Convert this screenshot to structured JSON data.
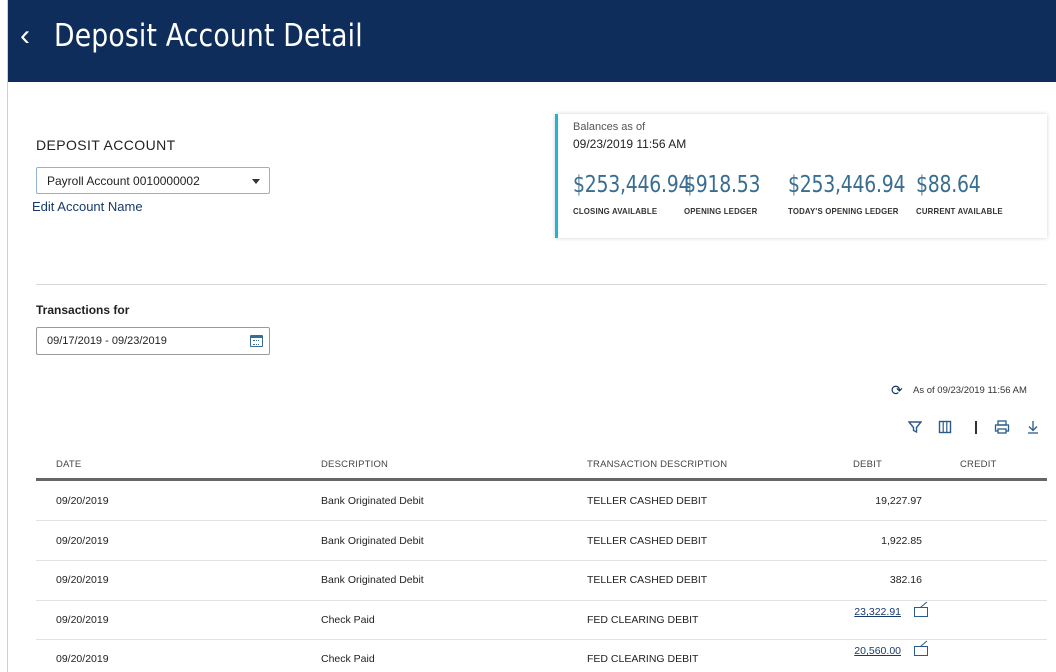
{
  "header": {
    "back_icon": "chevron-left-icon",
    "title": "Deposit Account Detail"
  },
  "account": {
    "label": "DEPOSIT ACCOUNT",
    "selected": "Payroll Account 0010000002",
    "edit_link": "Edit Account Name"
  },
  "balances": {
    "asof_label": "Balances as of",
    "asof_date": "09/23/2019 11:56 AM",
    "accent_color": "#1fb6d1",
    "items": [
      {
        "value": "$253,446.94",
        "caption": "CLOSING AVAILABLE"
      },
      {
        "value": "$918.53",
        "caption": "OPENING LEDGER"
      },
      {
        "value": "$253,446.94",
        "caption": "TODAY'S OPENING LEDGER"
      },
      {
        "value": "$88.64",
        "caption": "CURRENT AVAILABLE"
      }
    ]
  },
  "transactions": {
    "label": "Transactions for",
    "date_range": "09/17/2019 - 09/23/2019",
    "asof": "As of 09/23/2019 11:56 AM",
    "toolbar_icons": [
      "filter-icon",
      "columns-icon",
      "print-icon",
      "download-icon"
    ],
    "columns": [
      "DATE",
      "DESCRIPTION",
      "TRANSACTION DESCRIPTION",
      "DEBIT",
      "CREDIT"
    ],
    "rows": [
      {
        "date": "09/20/2019",
        "description": "Bank Originated Debit",
        "transaction_description": "TELLER CASHED DEBIT",
        "debit": "19,227.97",
        "credit": ""
      },
      {
        "date": "09/20/2019",
        "description": "Bank Originated Debit",
        "transaction_description": "TELLER CASHED DEBIT",
        "debit": "1,922.85",
        "credit": ""
      },
      {
        "date": "09/20/2019",
        "description": "Bank Originated Debit",
        "transaction_description": "TELLER CASHED DEBIT",
        "debit": "382.16",
        "credit": ""
      },
      {
        "date": "09/20/2019",
        "description": "Check Paid",
        "transaction_description": "FED CLEARING DEBIT",
        "debit": "23,322.91",
        "credit": ""
      },
      {
        "date": "09/20/2019",
        "description": "Check Paid",
        "transaction_description": "FED CLEARING DEBIT",
        "debit": "20,560.00",
        "credit": ""
      }
    ]
  },
  "colors": {
    "header_bg": "#0e2d5a",
    "balance_value": "#3a6d92",
    "link": "#163a6b"
  }
}
